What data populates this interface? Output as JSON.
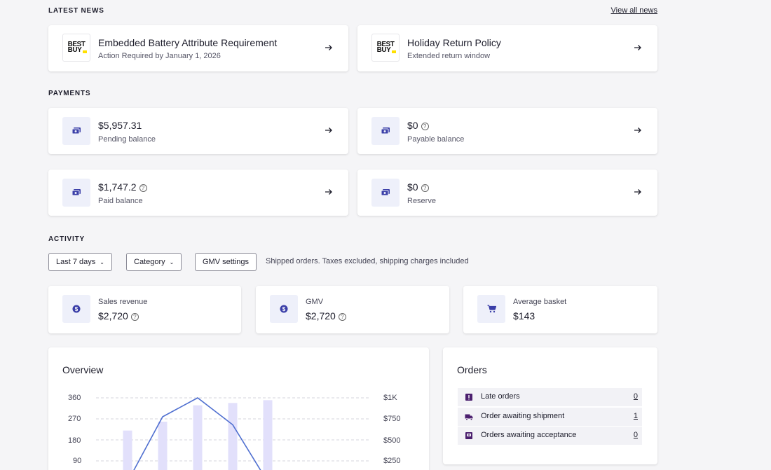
{
  "news": {
    "title": "LATEST NEWS",
    "view_all": "View all news",
    "items": [
      {
        "logo_top": "BEST",
        "logo_bottom": "BUY",
        "title": "Embedded Battery Attribute Requirement",
        "subtitle": "Action Required by January 1, 2026"
      },
      {
        "logo_top": "BEST",
        "logo_bottom": "BUY",
        "title": "Holiday Return Policy",
        "subtitle": "Extended return window"
      }
    ]
  },
  "payments": {
    "title": "PAYMENTS",
    "items": [
      {
        "value": "$5,957.31",
        "label": "Pending balance",
        "help": false
      },
      {
        "value": "$0",
        "label": "Payable balance",
        "help": true
      },
      {
        "value": "$1,747.2",
        "label": "Paid balance",
        "help": true
      },
      {
        "value": "$0",
        "label": "Reserve",
        "help": true
      }
    ]
  },
  "activity": {
    "title": "ACTIVITY",
    "filters": {
      "period": "Last 7 days",
      "category": "Category",
      "gmv_settings": "GMV settings"
    },
    "note": "Shipped orders. Taxes excluded, shipping charges included",
    "stats": [
      {
        "label": "Sales revenue",
        "value": "$2,720",
        "icon": "dollar-coin-icon"
      },
      {
        "label": "GMV",
        "value": "$2,720",
        "icon": "dollar-coin-icon"
      },
      {
        "label": "Average basket",
        "value": "$143",
        "icon": "shopping-cart-icon"
      }
    ]
  },
  "overview": {
    "title": "Overview"
  },
  "chart_data": {
    "type": "bar",
    "title": "Overview",
    "y_left_ticks": [
      "360",
      "270",
      "180",
      "90"
    ],
    "y_right_ticks": [
      "$1K",
      "$750",
      "$500",
      "$250"
    ],
    "ylim_left": [
      0,
      360
    ],
    "ylim_right": [
      0,
      1000
    ],
    "series": [
      {
        "kind": "bar",
        "values": [
          220,
          258,
          328,
          338,
          350
        ]
      },
      {
        "kind": "line",
        "values": [
          0,
          775,
          1000,
          680,
          0
        ]
      }
    ],
    "colors": {
      "bar": "#e2e0fb",
      "line": "#4f6fd0",
      "grid": "#d6d6de"
    }
  },
  "orders": {
    "title": "Orders",
    "rows": [
      {
        "label": "Late orders",
        "value": "0",
        "icon": "alert-icon"
      },
      {
        "label": "Order awaiting shipment",
        "value": "1",
        "icon": "truck-icon"
      },
      {
        "label": "Orders awaiting acceptance",
        "value": "0",
        "icon": "inbox-icon"
      }
    ]
  },
  "colors": {
    "accent": "#3b3fa8",
    "icon_bg": "#eef0fa",
    "order_icon": "#4b1f6e"
  }
}
